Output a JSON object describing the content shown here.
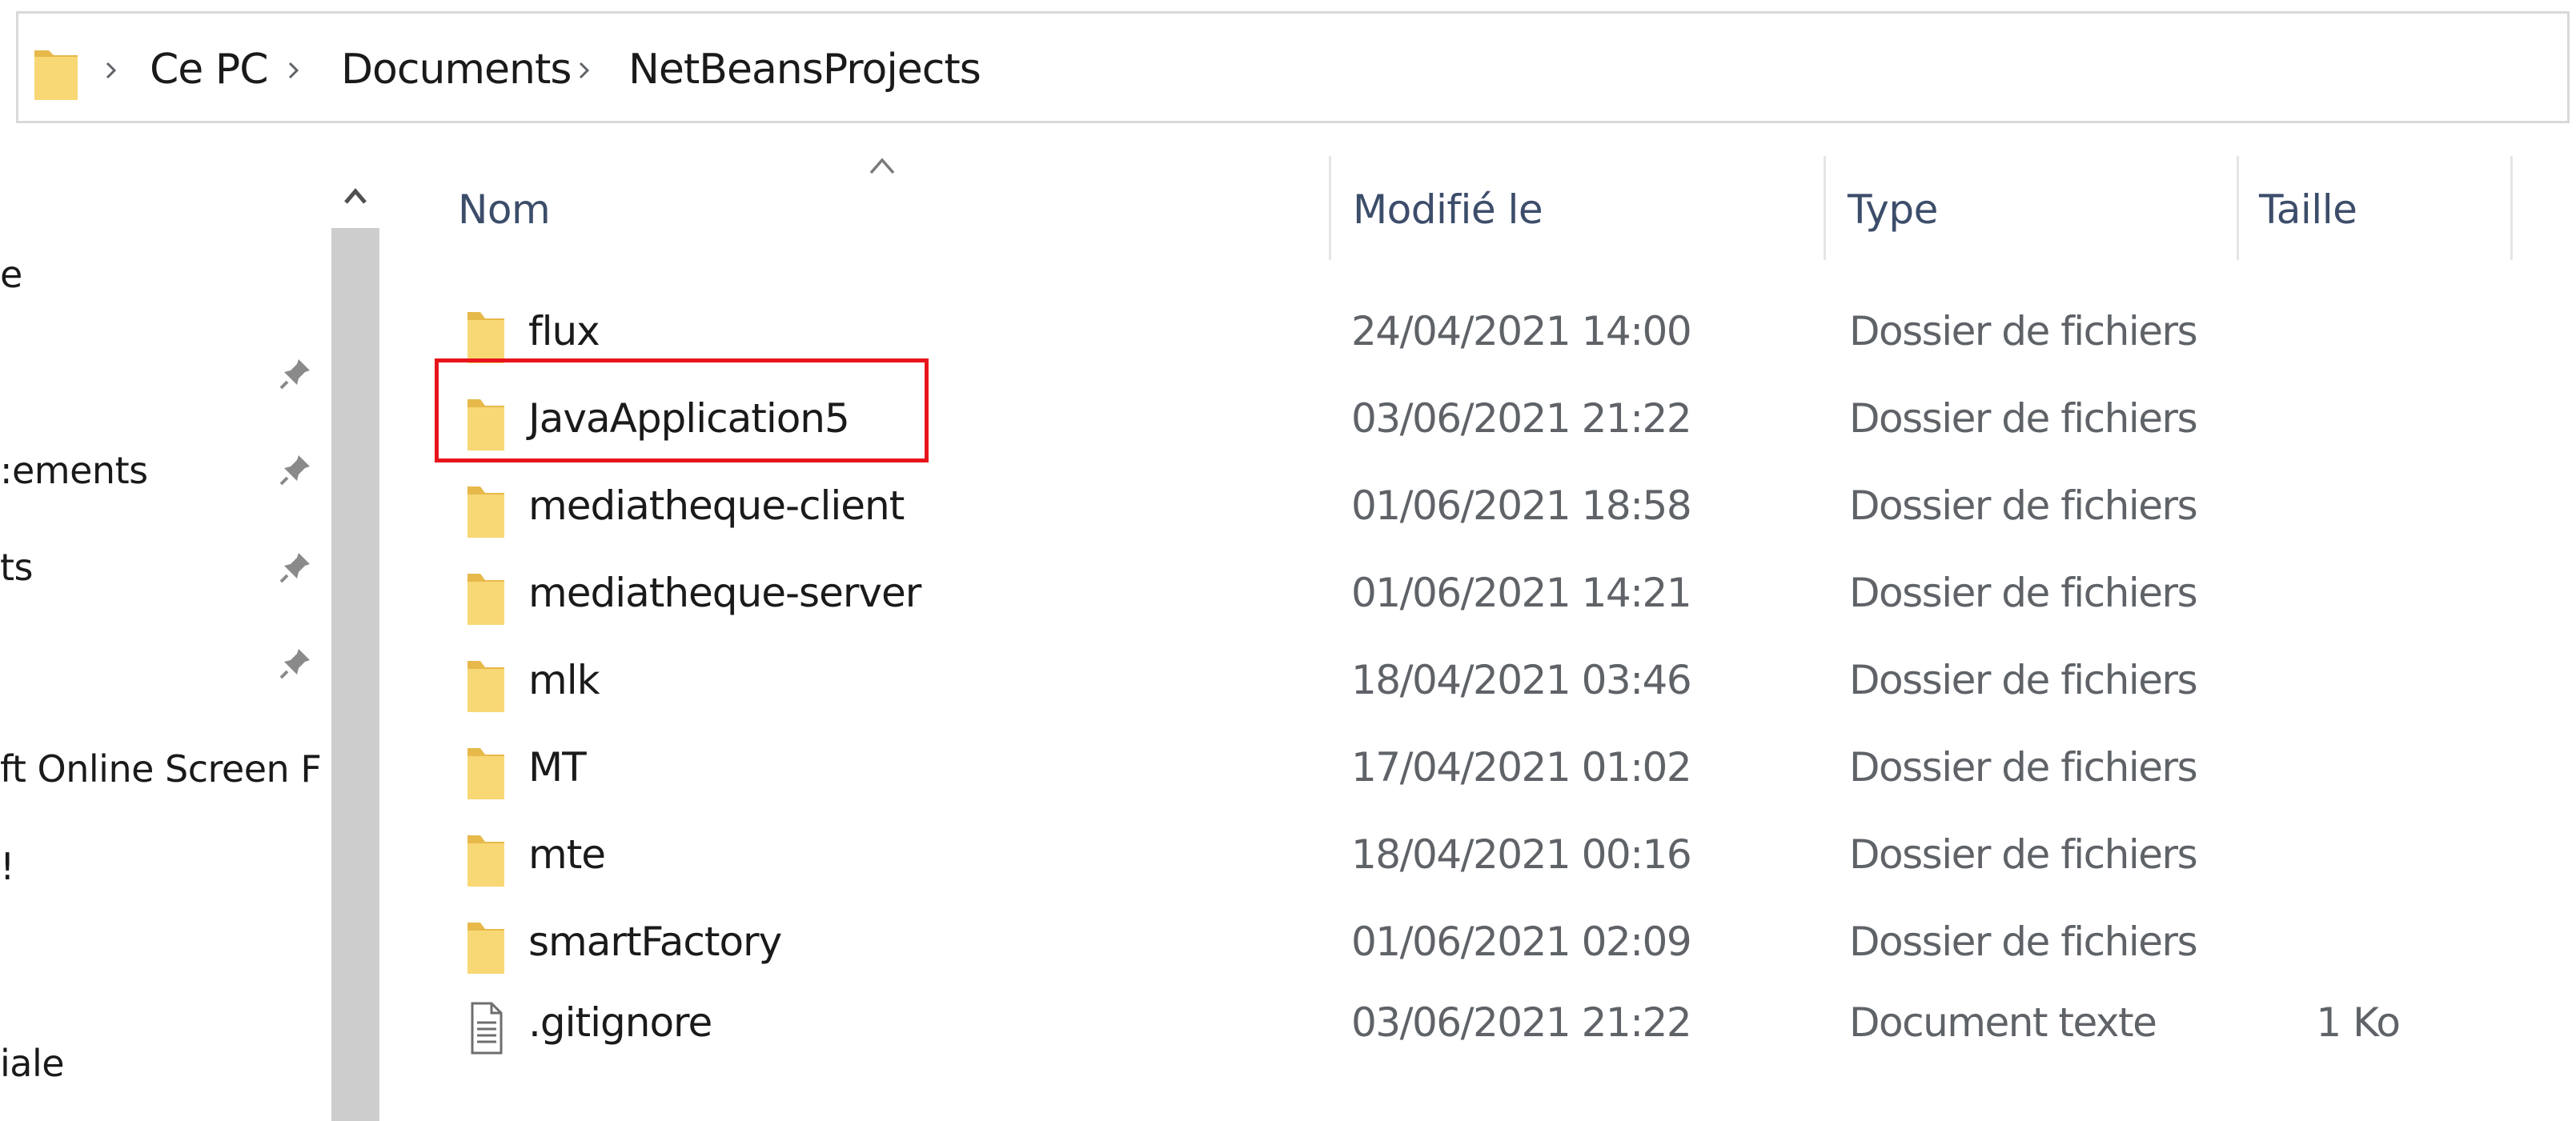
{
  "breadcrumb": {
    "items": [
      "Ce PC",
      "Documents",
      "NetBeansProjects"
    ]
  },
  "nav": {
    "items": [
      {
        "label": "e",
        "pinned": false
      },
      {
        "label": "",
        "pinned": true
      },
      {
        "label": ":ements",
        "pinned": true
      },
      {
        "label": "ts",
        "pinned": true
      },
      {
        "label": "",
        "pinned": true
      },
      {
        "label": "ft Online Screen F",
        "pinned": false
      },
      {
        "label": "!",
        "pinned": false
      },
      {
        "label": "iale",
        "pinned": false
      }
    ]
  },
  "columns": {
    "name": "Nom",
    "modified": "Modifié le",
    "type": "Type",
    "size": "Taille"
  },
  "files": [
    {
      "name": "flux",
      "modified": "24/04/2021 14:00",
      "type": "Dossier de fichiers",
      "size": "",
      "icon": "folder-icon"
    },
    {
      "name": "JavaApplication5",
      "modified": "03/06/2021 21:22",
      "type": "Dossier de fichiers",
      "size": "",
      "icon": "folder-icon",
      "highlighted": true
    },
    {
      "name": "mediatheque-client",
      "modified": "01/06/2021 18:58",
      "type": "Dossier de fichiers",
      "size": "",
      "icon": "folder-icon"
    },
    {
      "name": "mediatheque-server",
      "modified": "01/06/2021 14:21",
      "type": "Dossier de fichiers",
      "size": "",
      "icon": "folder-icon"
    },
    {
      "name": "mlk",
      "modified": "18/04/2021 03:46",
      "type": "Dossier de fichiers",
      "size": "",
      "icon": "folder-icon"
    },
    {
      "name": "MT",
      "modified": "17/04/2021 01:02",
      "type": "Dossier de fichiers",
      "size": "",
      "icon": "folder-icon"
    },
    {
      "name": "mte",
      "modified": "18/04/2021 00:16",
      "type": "Dossier de fichiers",
      "size": "",
      "icon": "folder-icon"
    },
    {
      "name": "smartFactory",
      "modified": "01/06/2021 02:09",
      "type": "Dossier de fichiers",
      "size": "",
      "icon": "folder-icon"
    },
    {
      "name": ".gitignore",
      "modified": "03/06/2021 21:22",
      "type": "Document texte",
      "size": "1 Ko",
      "icon": "text-file-icon"
    }
  ],
  "colors": {
    "folder": "#f8d775",
    "folder_dark": "#e6b94a",
    "highlight_border": "#e8141b",
    "header_text": "#3c4d6a",
    "scrollbar_thumb": "#cdcdcd"
  }
}
